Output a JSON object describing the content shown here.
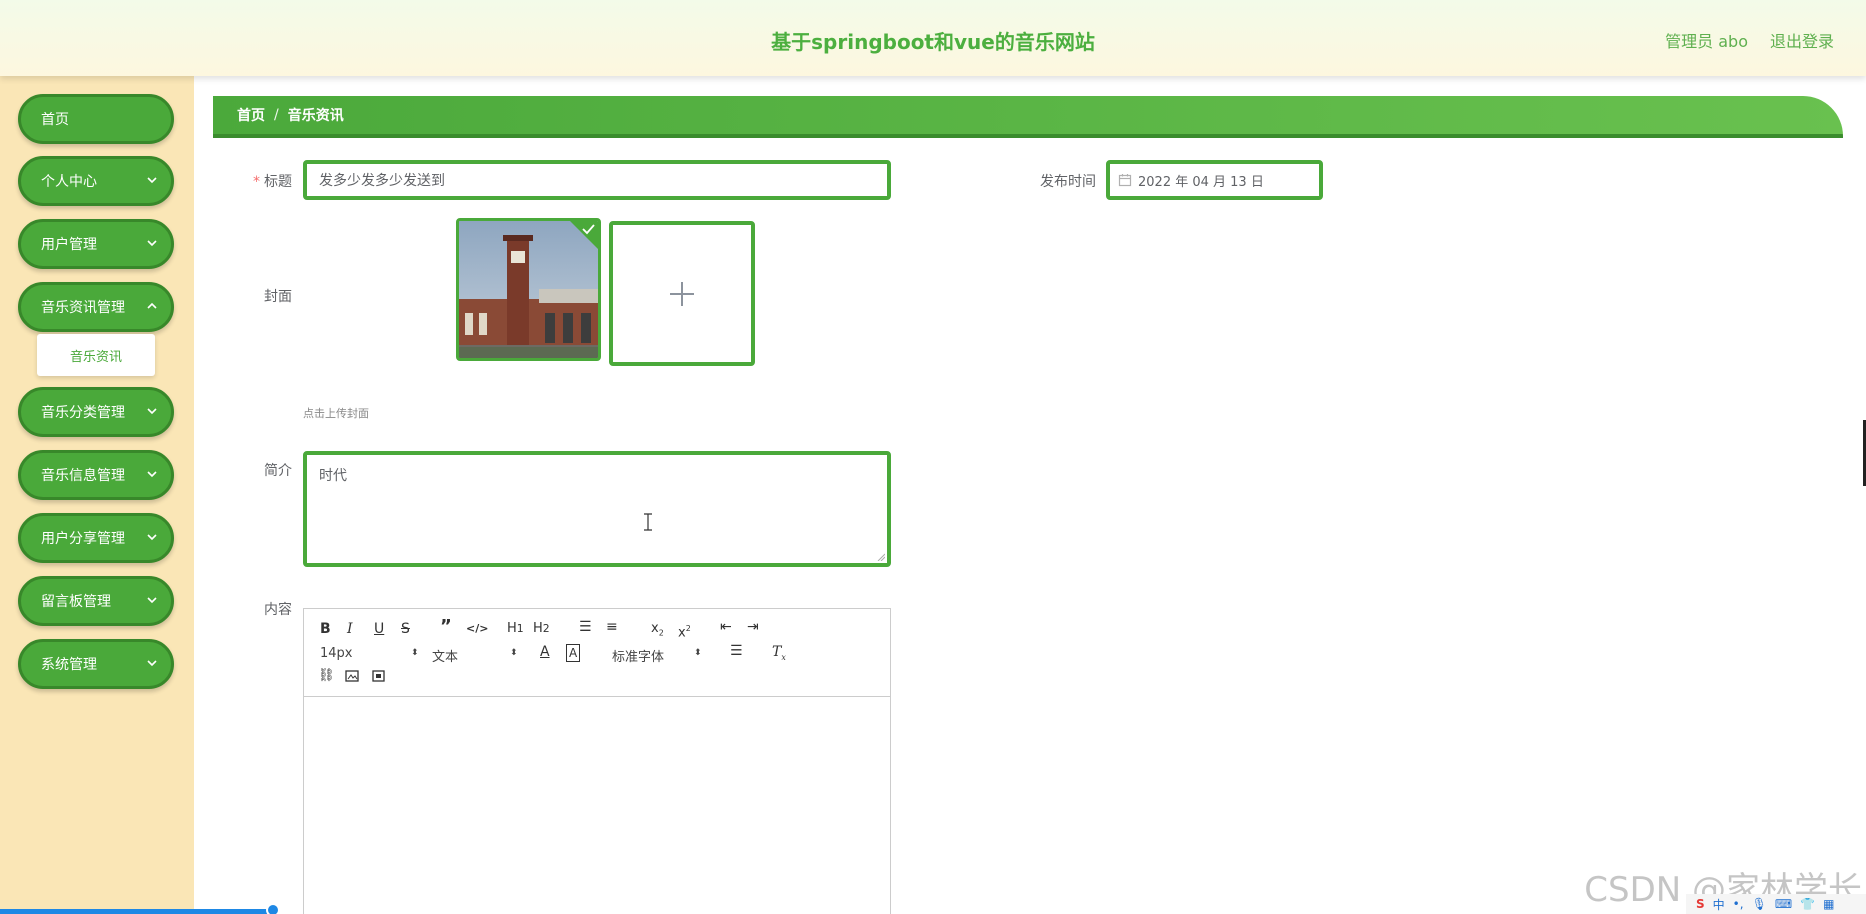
{
  "header": {
    "title": "基于springboot和vue的音乐网站",
    "user": "管理员 abo",
    "logout": "退出登录"
  },
  "sidebar": {
    "items": [
      {
        "label": "首页",
        "has_children": false
      },
      {
        "label": "个人中心",
        "has_children": true
      },
      {
        "label": "用户管理",
        "has_children": true
      },
      {
        "label": "音乐资讯管理",
        "has_children": true
      },
      {
        "label": "音乐分类管理",
        "has_children": true
      },
      {
        "label": "音乐信息管理",
        "has_children": true
      },
      {
        "label": "用户分享管理",
        "has_children": true
      },
      {
        "label": "留言板管理",
        "has_children": true
      },
      {
        "label": "系统管理",
        "has_children": true
      }
    ],
    "submenu": {
      "label": "音乐资讯"
    }
  },
  "breadcrumb": {
    "home": "首页",
    "separator": "/",
    "current": "音乐资讯"
  },
  "form": {
    "title_label": "标题",
    "title_value": "发多少发多少发送到",
    "publish_label": "发布时间",
    "publish_value": "2022 年 04 月 13 日",
    "cover_label": "封面",
    "cover_hint": "点击上传封面",
    "intro_label": "简介",
    "intro_value": "时代",
    "content_label": "内容"
  },
  "editor": {
    "font_size": "14px",
    "header_select": "文本",
    "font_family": "标准字体",
    "buttons": [
      "B",
      "I",
      "U",
      "S",
      "quote",
      "code",
      "H1",
      "H2",
      "ordered-list",
      "bullet-list",
      "sub",
      "sup",
      "outdent",
      "indent",
      "color",
      "background",
      "align",
      "clean",
      "link",
      "image",
      "video"
    ]
  },
  "watermark": "CSDN @家林学长",
  "colors": {
    "accent": "#4aa93a",
    "sidebar_bg": "#fae6b6",
    "title": "#4caf3f"
  }
}
